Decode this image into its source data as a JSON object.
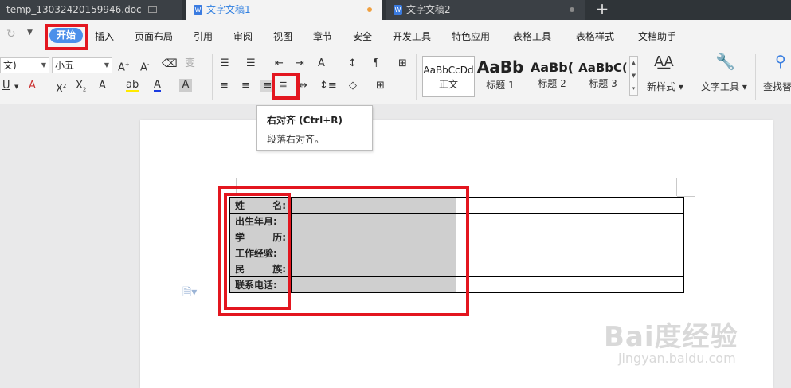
{
  "tabs": [
    {
      "label": "temp_13032420159946.doc",
      "state": "inactive"
    },
    {
      "label": "文字文稿1",
      "state": "active"
    },
    {
      "label": "文字文稿2",
      "state": "inactive"
    }
  ],
  "new_tab": "+",
  "menu": {
    "start": "开始",
    "items": [
      "插入",
      "页面布局",
      "引用",
      "审阅",
      "视图",
      "章节",
      "安全",
      "开发工具",
      "特色应用",
      "表格工具",
      "表格样式",
      "文档助手"
    ]
  },
  "toolbar": {
    "font_name": "文)",
    "font_size": "小五",
    "styles": [
      {
        "sample": "AaBbCcDd",
        "name": "正文"
      },
      {
        "sample": "AaBb",
        "name": "标题 1"
      },
      {
        "sample": "AaBb(",
        "name": "标题 2"
      },
      {
        "sample": "AaBbC(",
        "name": "标题 3"
      }
    ],
    "new_style": "新样式",
    "text_tools": "文字工具",
    "find_replace": "查找替"
  },
  "tooltip": {
    "title": "右对齐 (Ctrl+R)",
    "desc": "段落右对齐。"
  },
  "table": {
    "rows": [
      {
        "label": [
          "姓",
          "名:"
        ]
      },
      {
        "label": [
          "出生年月:"
        ]
      },
      {
        "label": [
          "学",
          "历:"
        ]
      },
      {
        "label": [
          "工作经验:"
        ]
      },
      {
        "label": [
          "民",
          "族:"
        ]
      },
      {
        "label": [
          "联系电话:"
        ]
      }
    ]
  },
  "watermark": {
    "main": "Bai度经验",
    "sub": "jingyan.baidu.com"
  },
  "colors": {
    "highlight": "#e3161f",
    "accent": "#4b8fea",
    "tabbar": "#2f3438"
  }
}
